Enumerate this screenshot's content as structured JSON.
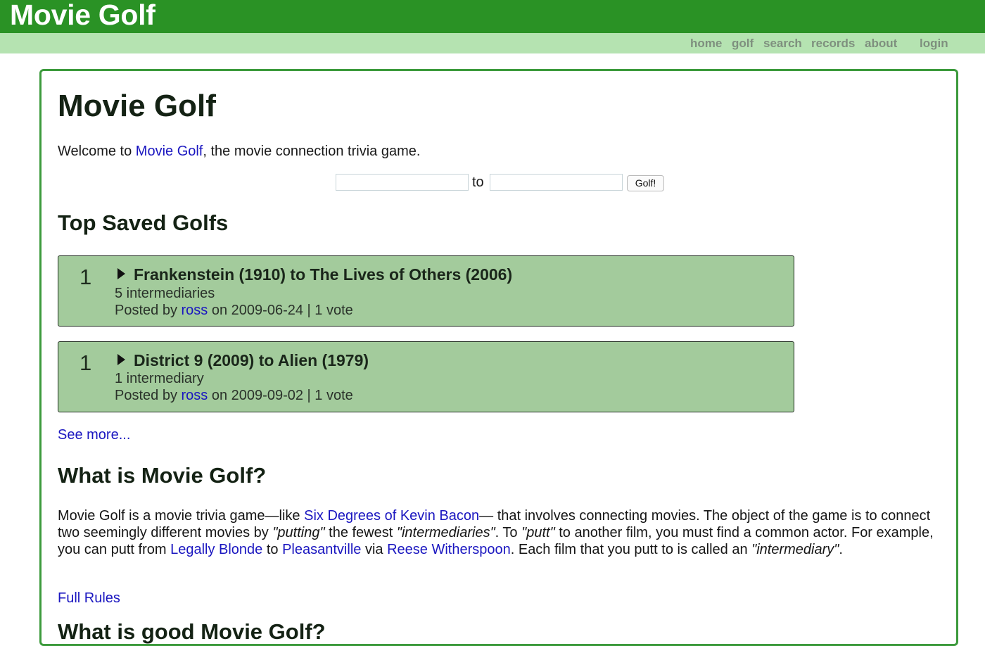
{
  "header": {
    "site_title": "Movie Golf",
    "nav": {
      "home": "home",
      "golf": "golf",
      "search": "search",
      "records": "records",
      "about": "about",
      "login": "login"
    }
  },
  "main": {
    "title": "Movie Golf",
    "intro": {
      "before": "Welcome to ",
      "link": "Movie Golf",
      "after": ", the movie connection trivia game."
    },
    "form": {
      "from_value": "",
      "to_label": "to",
      "to_value": "",
      "button_label": "Golf!"
    },
    "top_saved": {
      "heading": "Top Saved Golfs",
      "items": [
        {
          "rank": "1",
          "title": "Frankenstein (1910) to The Lives of Others (2006)",
          "intermediaries": "5 intermediaries",
          "posted_prefix": "Posted by ",
          "user": "ross",
          "posted_suffix": " on 2009-06-24 | 1 vote"
        },
        {
          "rank": "1",
          "title": "District 9 (2009) to Alien (1979)",
          "intermediaries": "1 intermediary",
          "posted_prefix": "Posted by ",
          "user": "ross",
          "posted_suffix": " on 2009-09-02 | 1 vote"
        }
      ],
      "see_more": "See more..."
    },
    "what_is": {
      "heading": "What is Movie Golf?",
      "p1": "Movie Golf is a movie trivia game—like ",
      "link_bacon": "Six Degrees of Kevin Bacon",
      "p2": "— that involves connecting movies. The object of the game is to connect two seemingly different movies by ",
      "em_putting": "\"putting\"",
      "p3": " the fewest ",
      "em_intermediaries": "\"intermediaries\"",
      "p4": ". To ",
      "em_putt": "\"putt\"",
      "p5": " to another film, you must find a common actor. For example, you can putt from ",
      "link_blonde": "Legally Blonde",
      "p6": " to ",
      "link_pleasantville": "Pleasantville",
      "p7": " via ",
      "link_reese": "Reese Witherspoon",
      "p8": ". Each film that you putt to is called an ",
      "em_intermediary": "\"intermediary\"",
      "p9": ".",
      "full_rules": "Full Rules"
    },
    "next_heading": "What is good Movie Golf?"
  },
  "colors": {
    "topbar": "#2a9225",
    "navbar": "#b5e3b1",
    "card": "#a3cb9c",
    "link": "#1a16c0",
    "box_border": "#3c9a3c"
  }
}
